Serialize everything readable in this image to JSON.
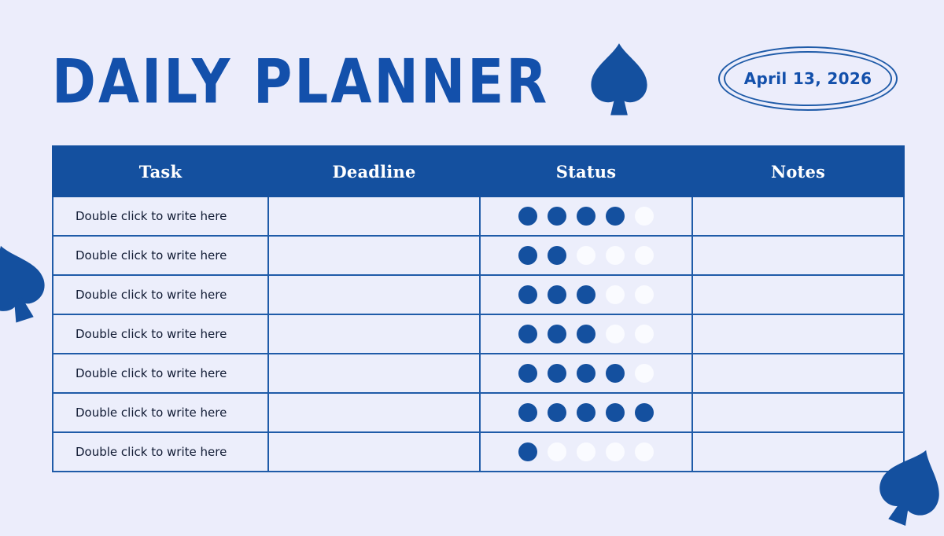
{
  "page": {
    "title": "DAILY PLANNER",
    "background_color": "#ecedfb",
    "accent_color": "#14509f"
  },
  "header": {
    "title": "DAILY PLANNER",
    "spade_icon": "spade-icon",
    "date_badge": {
      "date": "April 13, 2026"
    }
  },
  "table": {
    "columns": [
      "Task",
      "Deadline",
      "Status",
      "Notes"
    ],
    "rows": [
      {
        "task": "Double click to write here",
        "deadline": "",
        "status_filled": 4,
        "status_total": 5,
        "notes": ""
      },
      {
        "task": "Double click to write here",
        "deadline": "",
        "status_filled": 2,
        "status_total": 5,
        "notes": ""
      },
      {
        "task": "Double click to write here",
        "deadline": "",
        "status_filled": 3,
        "status_total": 5,
        "notes": ""
      },
      {
        "task": "Double click to write here",
        "deadline": "",
        "status_filled": 3,
        "status_total": 5,
        "notes": ""
      },
      {
        "task": "Double click to write here",
        "deadline": "",
        "status_filled": 4,
        "status_total": 5,
        "notes": ""
      },
      {
        "task": "Double click to write here",
        "deadline": "",
        "status_filled": 5,
        "status_total": 5,
        "notes": ""
      },
      {
        "task": "Double click to write here",
        "deadline": "",
        "status_filled": 1,
        "status_total": 5,
        "notes": ""
      }
    ]
  },
  "decorations": {
    "left_spade": "spade-icon",
    "bottom_right_spade": "spade-icon"
  }
}
